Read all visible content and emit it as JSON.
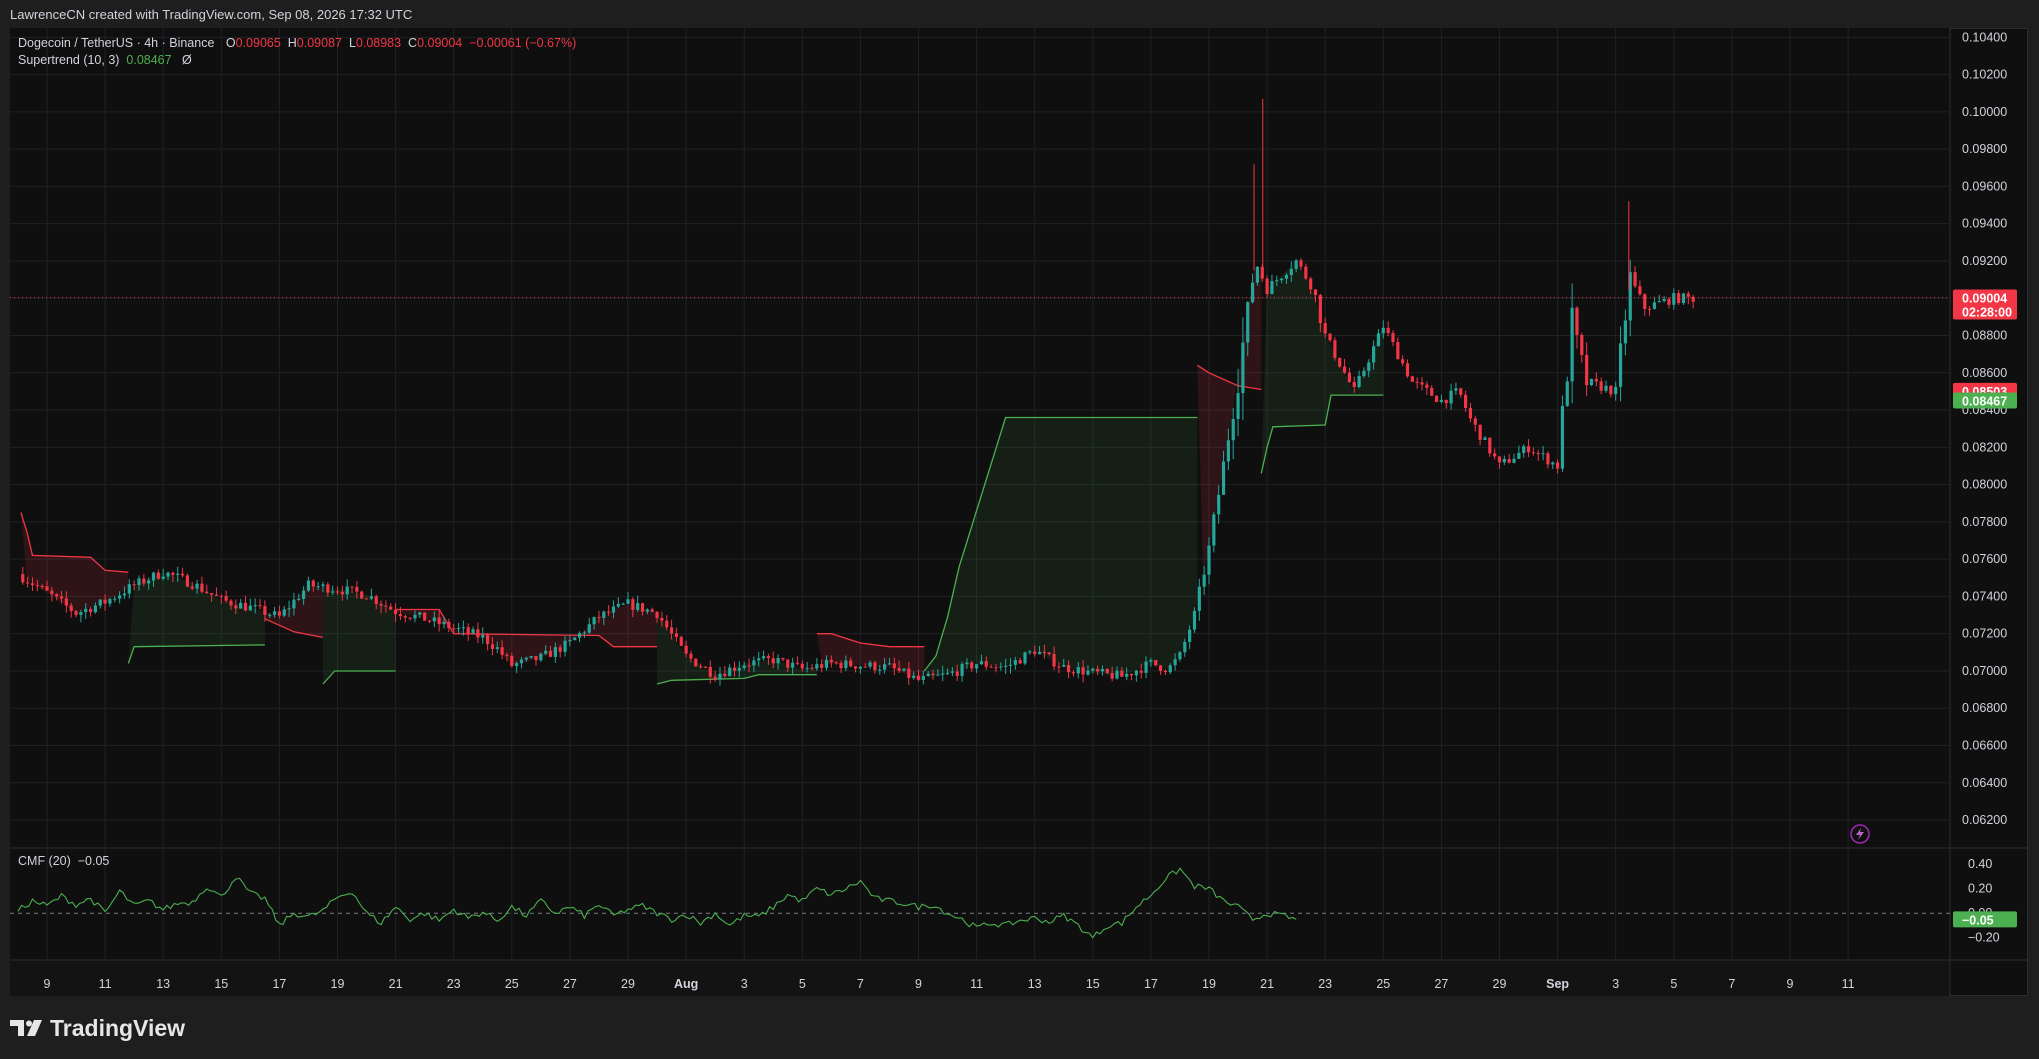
{
  "header": {
    "attribution": "LawrenceCN created with TradingView.com, Sep 08, 2026 17:32 UTC"
  },
  "legend": {
    "symbol": "Dogecoin / TetherUS · 4h · Binance",
    "open_label": "O",
    "open": "0.09065",
    "high_label": "H",
    "high": "0.09087",
    "low_label": "L",
    "low": "0.08983",
    "close_label": "C",
    "close": "0.09004",
    "change": "−0.00061 (−0.67%)",
    "indicator": "Supertrend (10, 3)",
    "indicator_value": "0.08467",
    "indicator_extra": "Ø"
  },
  "cmf_legend": {
    "name": "CMF (20)",
    "value": "−0.05"
  },
  "badges": {
    "price": "0.09004",
    "countdown": "02:28:00",
    "upper": "0.08503",
    "lower": "0.08467",
    "cmf": "−0.05"
  },
  "footer": {
    "brand": "TradingView"
  },
  "colors": {
    "up": "#26a69a",
    "down": "#f23645",
    "st_up": "#4caf50",
    "st_down": "#f23645",
    "grid": "#1f2126",
    "axis_text": "#d1d4dc",
    "cmf_line": "#4caf50",
    "bg": "#0f0f0f"
  },
  "icons": {
    "flash": "lightning-icon",
    "brand": "tradingview-logo-icon"
  },
  "chart_data": {
    "type": "candlestick",
    "symbol": "Dogecoin / TetherUS",
    "timeframe": "4h",
    "exchange": "Binance",
    "y_axis": {
      "ylim": [
        0.0605,
        0.1045
      ],
      "ticks": [
        "0.06200",
        "0.06400",
        "0.06600",
        "0.06800",
        "0.07000",
        "0.07200",
        "0.07400",
        "0.07600",
        "0.07800",
        "0.08000",
        "0.08200",
        "0.08400",
        "0.08600",
        "0.08800",
        "0.09000",
        "0.09200",
        "0.09400",
        "0.09600",
        "0.09800",
        "0.10000",
        "0.10200",
        "0.10400"
      ]
    },
    "x_axis": {
      "labels": [
        "9",
        "11",
        "13",
        "15",
        "17",
        "19",
        "21",
        "23",
        "25",
        "27",
        "29",
        "Aug",
        "3",
        "5",
        "7",
        "9",
        "11",
        "13",
        "15",
        "17",
        "19",
        "21",
        "23",
        "25",
        "27",
        "29",
        "Sep",
        "3",
        "5",
        "7",
        "9",
        "11"
      ],
      "label_index": [
        0,
        1,
        2,
        3,
        4,
        5,
        6,
        7,
        8,
        9,
        10,
        11,
        12,
        13,
        14,
        15,
        16,
        17,
        18,
        19,
        20,
        21,
        22,
        23,
        24,
        25,
        26,
        27,
        28,
        29,
        30,
        31
      ]
    },
    "price_path": [
      [
        8.0,
        0.0752
      ],
      [
        9.0,
        0.0742
      ],
      [
        10.0,
        0.0731
      ],
      [
        11.0,
        0.0737
      ],
      [
        12.0,
        0.0746
      ],
      [
        13.0,
        0.0753
      ],
      [
        14.0,
        0.0747
      ],
      [
        15.0,
        0.0738
      ],
      [
        16.0,
        0.0734
      ],
      [
        17.0,
        0.0729
      ],
      [
        18.0,
        0.0746
      ],
      [
        19.0,
        0.0744
      ],
      [
        20.0,
        0.0741
      ],
      [
        21.0,
        0.0732
      ],
      [
        22.0,
        0.0728
      ],
      [
        23.0,
        0.0723
      ],
      [
        24.0,
        0.0718
      ],
      [
        24.5,
        0.0712
      ],
      [
        25.0,
        0.0703
      ],
      [
        26.0,
        0.0707
      ],
      [
        27.0,
        0.0715
      ],
      [
        28.0,
        0.0729
      ],
      [
        29.0,
        0.0736
      ],
      [
        30.0,
        0.0731
      ],
      [
        31.0,
        0.0708
      ],
      [
        32.0,
        0.0698
      ],
      [
        33.0,
        0.0704
      ],
      [
        34.0,
        0.0706
      ],
      [
        35.0,
        0.0701
      ],
      [
        36.0,
        0.0704
      ],
      [
        37.0,
        0.0703
      ],
      [
        38.0,
        0.0702
      ],
      [
        39.0,
        0.0695
      ],
      [
        40.0,
        0.0698
      ],
      [
        41.0,
        0.0704
      ],
      [
        42.0,
        0.0702
      ],
      [
        43.0,
        0.0711
      ],
      [
        44.0,
        0.0702
      ],
      [
        45.0,
        0.0699
      ],
      [
        46.0,
        0.0697
      ],
      [
        47.0,
        0.0704
      ],
      [
        47.6,
        0.0701
      ],
      [
        48.0,
        0.0708
      ],
      [
        48.5,
        0.073
      ],
      [
        49.0,
        0.0765
      ],
      [
        49.5,
        0.081
      ],
      [
        50.0,
        0.0858
      ],
      [
        50.6,
        0.092
      ],
      [
        51.0,
        0.0905
      ],
      [
        52.0,
        0.092
      ],
      [
        52.6,
        0.0905
      ],
      [
        53.0,
        0.088
      ],
      [
        54.0,
        0.085
      ],
      [
        55.0,
        0.0885
      ],
      [
        56.0,
        0.0855
      ],
      [
        57.0,
        0.0845
      ],
      [
        57.6,
        0.085
      ],
      [
        58.0,
        0.0835
      ],
      [
        59.0,
        0.081
      ],
      [
        60.0,
        0.082
      ],
      [
        61.0,
        0.081
      ],
      [
        61.5,
        0.0885
      ],
      [
        62.0,
        0.0855
      ],
      [
        63.0,
        0.085
      ],
      [
        63.5,
        0.091
      ],
      [
        64.0,
        0.0895
      ],
      [
        65.0,
        0.09
      ],
      [
        65.7,
        0.09
      ]
    ],
    "supertrend": {
      "length": 10,
      "factor": 3,
      "current_value": 0.08467,
      "segments": [
        {
          "dir": "down",
          "points": [
            [
              8.1,
              0.0785
            ],
            [
              8.3,
              0.0775
            ],
            [
              8.5,
              0.0762
            ],
            [
              10.5,
              0.0761
            ],
            [
              11.0,
              0.0754
            ],
            [
              11.8,
              0.0753
            ]
          ]
        },
        {
          "dir": "up",
          "points": [
            [
              11.8,
              0.0704
            ],
            [
              12.0,
              0.0713
            ],
            [
              16.5,
              0.0714
            ]
          ]
        },
        {
          "dir": "down",
          "points": [
            [
              16.5,
              0.0728
            ],
            [
              17.5,
              0.0721
            ],
            [
              18.5,
              0.0718
            ]
          ]
        },
        {
          "dir": "up",
          "points": [
            [
              18.5,
              0.0693
            ],
            [
              18.9,
              0.07
            ],
            [
              21.0,
              0.07
            ]
          ]
        },
        {
          "dir": "down",
          "points": [
            [
              21.0,
              0.0733
            ],
            [
              22.5,
              0.0733
            ],
            [
              23.0,
              0.072
            ],
            [
              28.0,
              0.0719
            ],
            [
              28.5,
              0.0713
            ],
            [
              30.0,
              0.0713
            ]
          ]
        },
        {
          "dir": "up",
          "points": [
            [
              30.0,
              0.0693
            ],
            [
              30.5,
              0.0695
            ],
            [
              33.0,
              0.0696
            ],
            [
              33.5,
              0.0698
            ],
            [
              35.5,
              0.0698
            ]
          ]
        },
        {
          "dir": "down",
          "points": [
            [
              35.5,
              0.072
            ],
            [
              36.0,
              0.072
            ],
            [
              37.0,
              0.0715
            ],
            [
              38.0,
              0.0713
            ],
            [
              39.2,
              0.0713
            ]
          ]
        },
        {
          "dir": "up",
          "points": [
            [
              39.2,
              0.07
            ],
            [
              39.6,
              0.0708
            ],
            [
              40.0,
              0.0729
            ],
            [
              40.4,
              0.0756
            ],
            [
              40.8,
              0.0776
            ],
            [
              41.2,
              0.0796
            ],
            [
              41.6,
              0.0816
            ],
            [
              42.0,
              0.0836
            ],
            [
              48.6,
              0.0836
            ]
          ]
        },
        {
          "dir": "down",
          "points": [
            [
              48.6,
              0.0864
            ],
            [
              49.0,
              0.086
            ],
            [
              50.0,
              0.0853
            ],
            [
              50.8,
              0.0851
            ]
          ]
        },
        {
          "dir": "up",
          "points": [
            [
              50.8,
              0.0806
            ],
            [
              51.0,
              0.082
            ],
            [
              51.2,
              0.0831
            ],
            [
              53.0,
              0.0832
            ],
            [
              53.2,
              0.0848
            ],
            [
              55.0,
              0.0848
            ]
          ]
        }
      ]
    },
    "cmf": {
      "period": 20,
      "current_value": -0.05,
      "ylim": [
        -0.3,
        0.45
      ],
      "ticks": [
        "0.40",
        "0.20",
        "0.00",
        "−0.20"
      ],
      "path": [
        [
          8.0,
          0.02
        ],
        [
          8.5,
          0.1
        ],
        [
          9.0,
          0.06
        ],
        [
          9.5,
          0.14
        ],
        [
          10.0,
          0.07
        ],
        [
          10.5,
          0.12
        ],
        [
          11.0,
          0.0
        ],
        [
          11.5,
          0.18
        ],
        [
          12.0,
          0.06
        ],
        [
          12.5,
          0.1
        ],
        [
          13.0,
          0.03
        ],
        [
          13.5,
          0.08
        ],
        [
          14.0,
          0.09
        ],
        [
          14.5,
          0.22
        ],
        [
          15.0,
          0.13
        ],
        [
          15.5,
          0.3
        ],
        [
          16.0,
          0.16
        ],
        [
          16.5,
          0.12
        ],
        [
          17.0,
          -0.1
        ],
        [
          17.5,
          0.0
        ],
        [
          18.0,
          -0.03
        ],
        [
          18.5,
          0.02
        ],
        [
          19.0,
          0.13
        ],
        [
          19.5,
          0.18
        ],
        [
          20.0,
          0.0
        ],
        [
          20.5,
          -0.08
        ],
        [
          21.0,
          0.05
        ],
        [
          21.5,
          -0.05
        ],
        [
          22.0,
          0.0
        ],
        [
          22.5,
          -0.06
        ],
        [
          23.0,
          0.03
        ],
        [
          23.5,
          -0.04
        ],
        [
          24.0,
          0.01
        ],
        [
          24.5,
          -0.06
        ],
        [
          25.0,
          0.05
        ],
        [
          25.5,
          -0.02
        ],
        [
          26.0,
          0.1
        ],
        [
          26.5,
          0.0
        ],
        [
          27.0,
          0.05
        ],
        [
          27.5,
          -0.02
        ],
        [
          28.0,
          0.07
        ],
        [
          28.5,
          -0.02
        ],
        [
          29.0,
          0.03
        ],
        [
          29.5,
          0.06
        ],
        [
          30.0,
          0.0
        ],
        [
          30.5,
          -0.05
        ],
        [
          31.0,
          -0.01
        ],
        [
          31.5,
          -0.08
        ],
        [
          32.0,
          0.0
        ],
        [
          32.5,
          -0.1
        ],
        [
          33.0,
          -0.02
        ],
        [
          33.5,
          -0.03
        ],
        [
          34.0,
          0.05
        ],
        [
          34.5,
          0.15
        ],
        [
          35.0,
          0.1
        ],
        [
          35.5,
          0.2
        ],
        [
          36.0,
          0.15
        ],
        [
          36.5,
          0.2
        ],
        [
          37.0,
          0.26
        ],
        [
          37.5,
          0.12
        ],
        [
          38.0,
          0.1
        ],
        [
          38.5,
          0.08
        ],
        [
          39.0,
          0.05
        ],
        [
          39.5,
          0.07
        ],
        [
          40.0,
          0.0
        ],
        [
          40.5,
          -0.05
        ],
        [
          41.0,
          -0.12
        ],
        [
          41.5,
          -0.08
        ],
        [
          42.0,
          -0.1
        ],
        [
          42.5,
          -0.06
        ],
        [
          43.0,
          -0.04
        ],
        [
          43.5,
          -0.07
        ],
        [
          44.0,
          -0.02
        ],
        [
          44.5,
          -0.1
        ],
        [
          45.0,
          -0.2
        ],
        [
          45.5,
          -0.1
        ],
        [
          46.0,
          -0.08
        ],
        [
          46.5,
          0.05
        ],
        [
          47.0,
          0.15
        ],
        [
          47.5,
          0.28
        ],
        [
          48.0,
          0.36
        ],
        [
          48.5,
          0.22
        ],
        [
          49.0,
          0.2
        ],
        [
          49.5,
          0.1
        ],
        [
          50.0,
          0.05
        ],
        [
          50.5,
          -0.05
        ],
        [
          51.0,
          0.0
        ],
        [
          51.5,
          -0.02
        ],
        [
          52.0,
          -0.05
        ]
      ]
    },
    "price_line": {
      "value": 0.09004,
      "style": "dotted",
      "color": "#f23645"
    },
    "grid": true,
    "annotations": [
      "lightning-icon bottom-right of price pane"
    ]
  }
}
